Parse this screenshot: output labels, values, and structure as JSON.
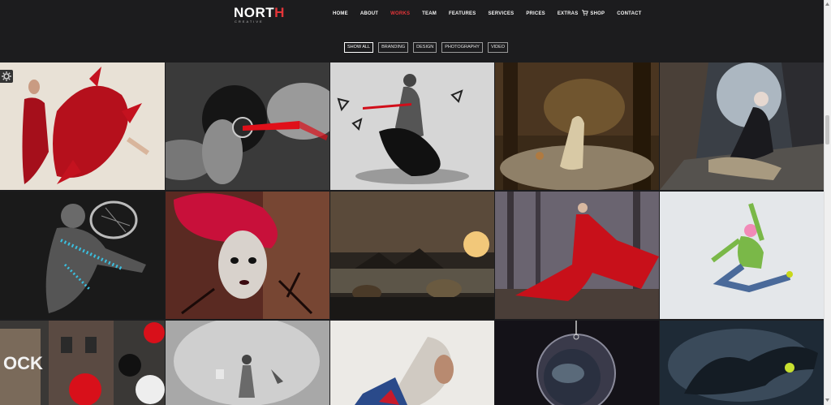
{
  "brand": {
    "name_main": "NORT",
    "name_accent": "H",
    "tagline": "CREATIVE"
  },
  "nav": {
    "items": [
      "HOME",
      "ABOUT",
      "WORKS",
      "TEAM",
      "FEATURES",
      "SERVICES",
      "PRICES",
      "EXTRAS",
      "SHOP",
      "CONTACT"
    ],
    "active": "WORKS",
    "cart_icon": "shopping-cart-icon"
  },
  "filters": {
    "items": [
      "SHOW ALL",
      "BRANDING",
      "DESIGN",
      "PHOTOGRAPHY",
      "VIDEO"
    ],
    "active": "SHOW ALL"
  },
  "portfolio": {
    "tiles": [
      "woman-red-paint-splash",
      "headphones-red-light",
      "dancer-triangles",
      "forest-deer-fantasy",
      "gothic-girl-street",
      "tennis-player-sparkle",
      "red-flower-headdress",
      "sunset-shore-animals",
      "red-dress-forest",
      "jumping-dancer-green",
      "graffiti-street-balloons",
      "misty-figure",
      "abstract-profile",
      "glass-planet-orb",
      "ink-splash-dancer"
    ]
  },
  "colors": {
    "background": "#1c1c1e",
    "accent": "#e43539",
    "text": "#f2f2f2"
  },
  "ui": {
    "settings_icon": "gear-icon"
  }
}
